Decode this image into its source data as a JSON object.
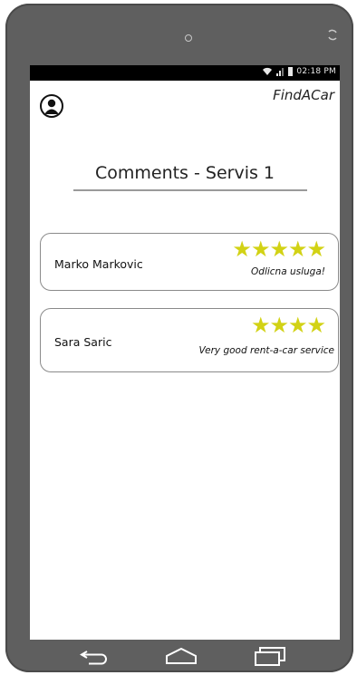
{
  "status_bar": {
    "time": "02:18 PM"
  },
  "header": {
    "app_title": "FindACar"
  },
  "page": {
    "title": "Comments - Servis 1"
  },
  "comments": [
    {
      "author": "Marko Markovic",
      "stars": 5,
      "stars_text": "★★★★★",
      "text": "Odlicna usluga!"
    },
    {
      "author": "Sara Saric",
      "stars": 4,
      "stars_text": "★★★★",
      "text": "Very good rent-a-car service"
    }
  ],
  "icons": {
    "profile": "user-avatar-icon",
    "back": "back-arrow-icon",
    "home": "home-icon",
    "recents": "recent-apps-icon",
    "wifi": "wifi-icon",
    "signal": "signal-icon",
    "battery": "battery-icon",
    "rotate": "rotate-icon"
  },
  "colors": {
    "star": "#d2d215",
    "phone_frame": "#5f5f5f"
  }
}
